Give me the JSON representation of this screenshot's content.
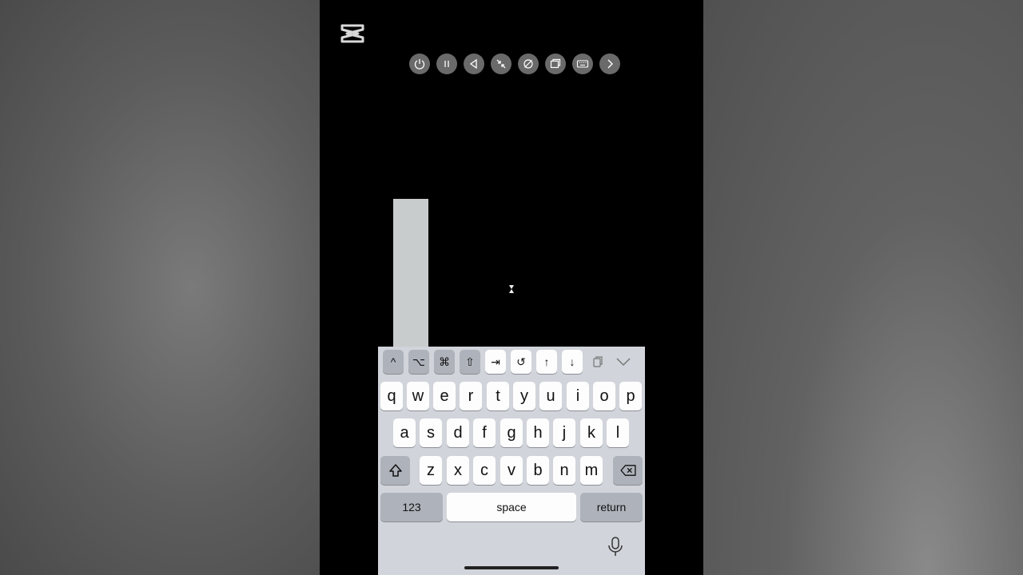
{
  "toolbar": {
    "icons": [
      "power-icon",
      "pause-icon",
      "back-triangle-icon",
      "shrink-icon",
      "pointer-off-icon",
      "windows-icon",
      "keyboard-icon",
      "forward-chevron-icon"
    ]
  },
  "keyboard": {
    "modifier_row": [
      "^",
      "⌥",
      "⌘",
      "⇧",
      "⇥",
      "↺",
      "↑",
      "↓"
    ],
    "row1": [
      "q",
      "w",
      "e",
      "r",
      "t",
      "y",
      "u",
      "i",
      "o",
      "p"
    ],
    "row2": [
      "a",
      "s",
      "d",
      "f",
      "g",
      "h",
      "j",
      "k",
      "l"
    ],
    "row3": [
      "z",
      "x",
      "c",
      "v",
      "b",
      "n",
      "m"
    ],
    "numbers_label": "123",
    "space_label": "space",
    "return_label": "return"
  },
  "colors": {
    "screen_bg": "#000000",
    "keyboard_bg": "#d1d4da",
    "key_light": "#fdfdfd",
    "key_dark": "#aeb3bb",
    "toolbar_button": "#6a6a6a"
  }
}
